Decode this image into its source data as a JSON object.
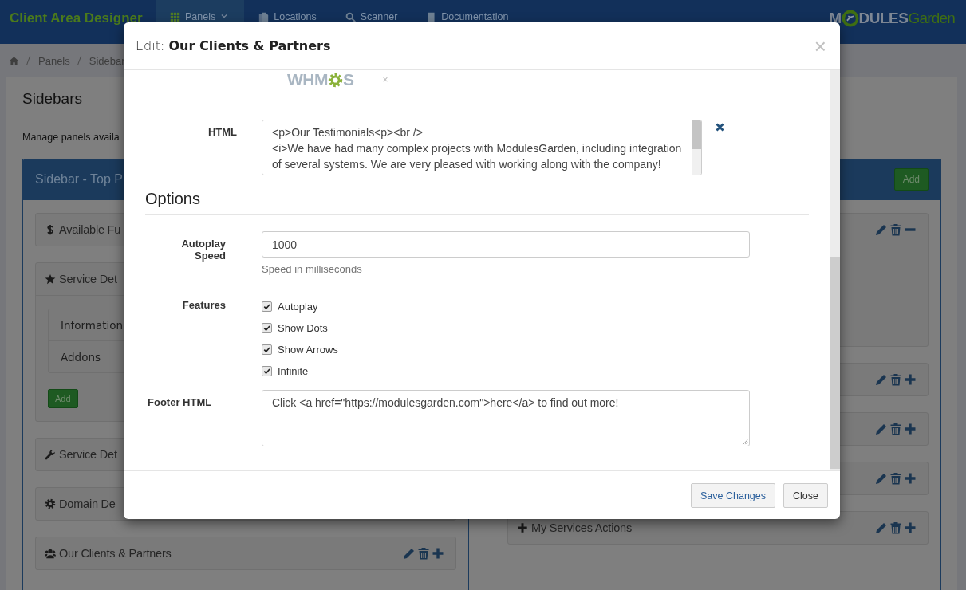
{
  "topbar": {
    "brand": "Client Area Designer",
    "nav": [
      {
        "label": "Panels",
        "selected": true,
        "dropdown": true
      },
      {
        "label": "Locations",
        "selected": false,
        "dropdown": false
      },
      {
        "label": "Scanner",
        "selected": false,
        "dropdown": false
      },
      {
        "label": "Documentation",
        "selected": false,
        "dropdown": false
      }
    ],
    "logo": {
      "first": "M",
      "middle": "DULES",
      "last": "Garden"
    }
  },
  "breadcrumb": [
    "Panels",
    "Sidebar"
  ],
  "page": {
    "title": "Sidebars",
    "description": "Manage panels availa"
  },
  "panels": [
    {
      "title": "Sidebar - Top P",
      "items": [
        {
          "label": "Available Fu",
          "expanded": false
        },
        {
          "label": "Service Det",
          "expanded": true,
          "children": [
            "Information",
            "Addons"
          ],
          "add_button": "Add"
        },
        {
          "label": "Service Det",
          "expanded": false
        },
        {
          "label": "Domain De",
          "expanded": false
        },
        {
          "label": "Our Clients & Partners",
          "expanded": false,
          "actions": true
        }
      ]
    },
    {
      "add_button": "Add",
      "items": [
        {
          "expanded": true,
          "actions": true
        },
        {
          "expanded": false,
          "actions": true
        },
        {
          "expanded": false,
          "actions": true
        },
        {
          "expanded": false,
          "actions": true
        },
        {
          "label": "My Services Actions",
          "expanded": false,
          "actions": true
        }
      ]
    }
  ],
  "modal": {
    "title_prefix": "Edit:",
    "title": "Our Clients & Partners",
    "close": "×",
    "image": {
      "logo_start": "WHM",
      "logo_end": "S",
      "remove": "×"
    },
    "html_field": {
      "label": "HTML",
      "value": "<p>Our Testimonials<p><br />\n<i>We have had many complex projects with ModulesGarden, including integration of several systems. We are very pleased with working along with the company!"
    },
    "options_heading": "Options",
    "speed": {
      "label": "Autoplay Speed",
      "value": "1000",
      "help": "Speed in milliseconds"
    },
    "features": {
      "label": "Features",
      "items": [
        {
          "label": "Autoplay",
          "checked": true
        },
        {
          "label": "Show Dots",
          "checked": true
        },
        {
          "label": "Show Arrows",
          "checked": true
        },
        {
          "label": "Infinite",
          "checked": true
        }
      ]
    },
    "footer_html": {
      "label": "Footer HTML",
      "value": "Click <a href=\"https://modulesgarden.com\">here</a> to find out more!"
    },
    "buttons": [
      {
        "label": "Save Changes",
        "kind": "primary"
      },
      {
        "label": "Close",
        "kind": "default"
      }
    ]
  }
}
